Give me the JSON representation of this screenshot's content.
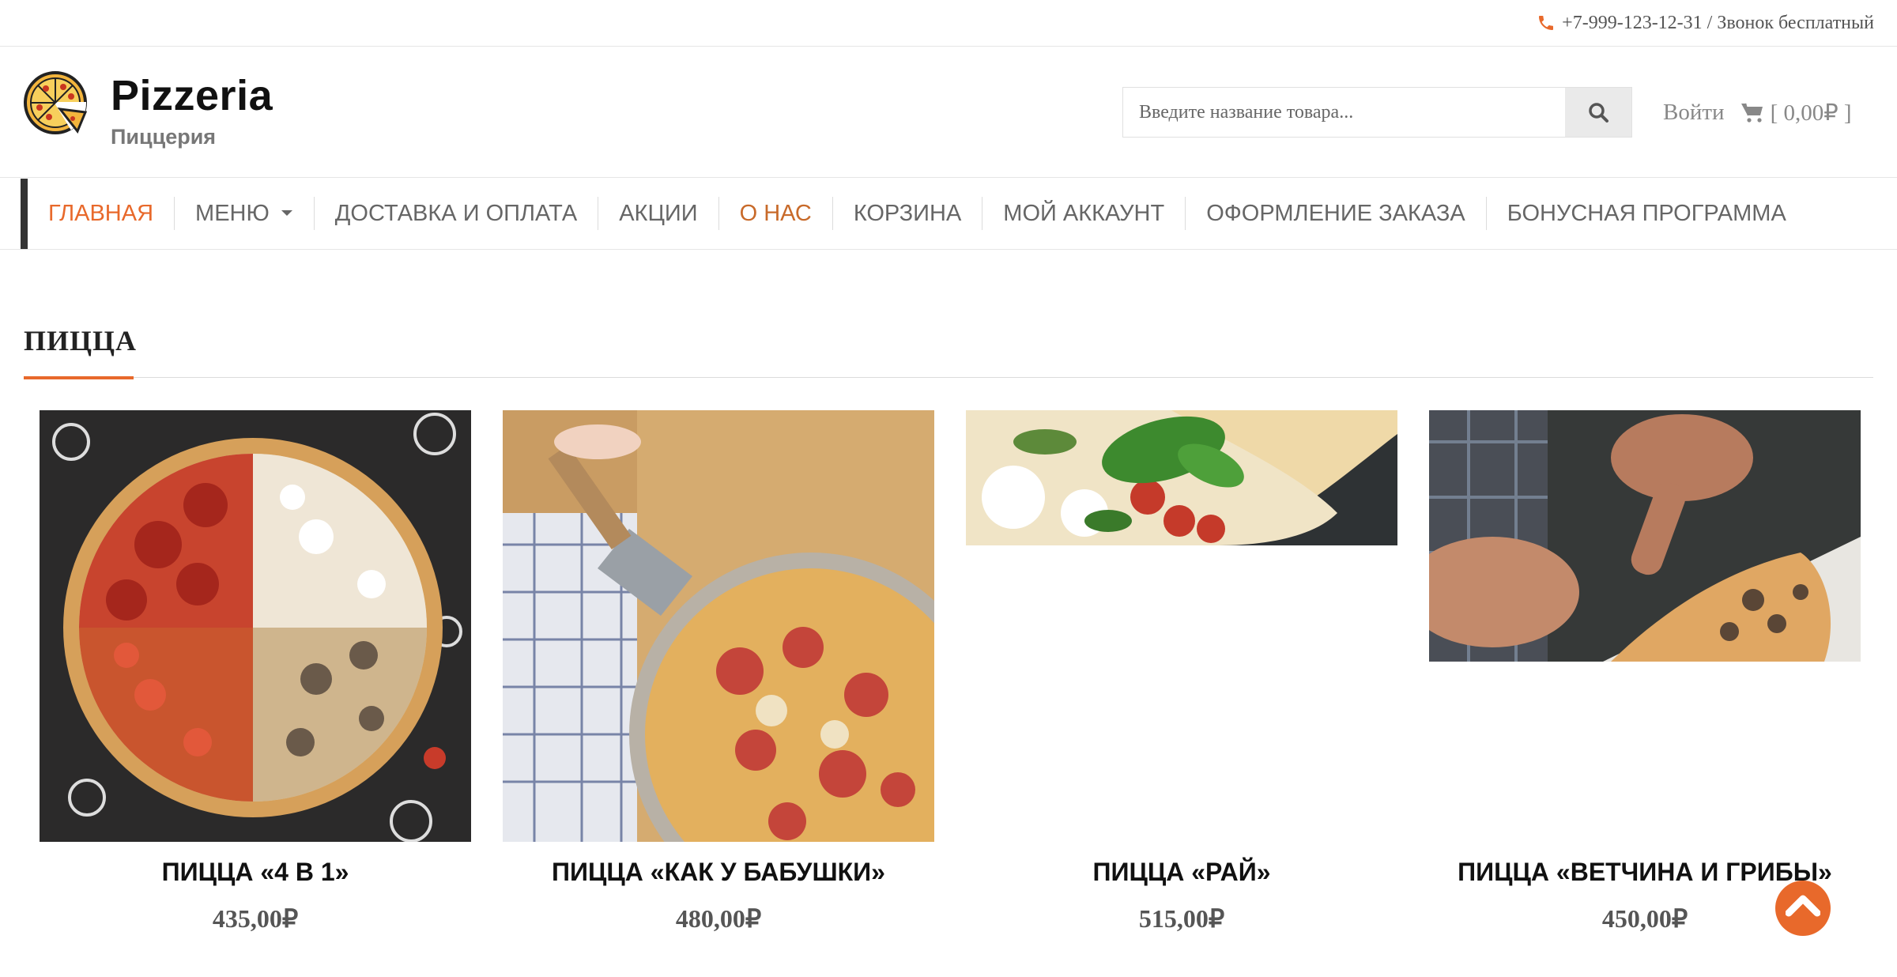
{
  "topbar": {
    "phone_text": "+7-999-123-12-31 / Звонок бесплатный",
    "phone_icon": "phone-icon",
    "accent_color": "#e8692b"
  },
  "header": {
    "site_title": "Pizzeria",
    "site_subtitle": "Пиццерия",
    "search_placeholder": "Введите название товара...",
    "search_icon": "search-icon",
    "login_label": "Войти",
    "cart_label": "[ 0,00₽ ]",
    "cart_icon": "shopping-cart-icon"
  },
  "nav": {
    "items": [
      {
        "label": "ГЛАВНАЯ"
      },
      {
        "label": "МЕНЮ"
      },
      {
        "label": "ДОСТАВКА И ОПЛАТА"
      },
      {
        "label": "АКЦИИ"
      },
      {
        "label": "О НАС"
      },
      {
        "label": "КОРЗИНА"
      },
      {
        "label": "МОЙ АККАУНТ"
      },
      {
        "label": "ОФОРМЛЕНИЕ ЗАКАЗА"
      },
      {
        "label": "БОНУСНАЯ ПРОГРАММА"
      }
    ],
    "active_color": "#e8692b"
  },
  "section": {
    "title": "ПИЦЦА"
  },
  "products": [
    {
      "name": "ПИЦЦА «4 В 1»",
      "price": "435,00₽"
    },
    {
      "name": "ПИЦЦА «КАК У БАБУШКИ»",
      "price": "480,00₽"
    },
    {
      "name": "ПИЦЦА «РАЙ»",
      "price": "515,00₽"
    },
    {
      "name": "ПИЦЦА «ВЕТЧИНА И ГРИБЫ»",
      "price": "450,00₽"
    }
  ]
}
